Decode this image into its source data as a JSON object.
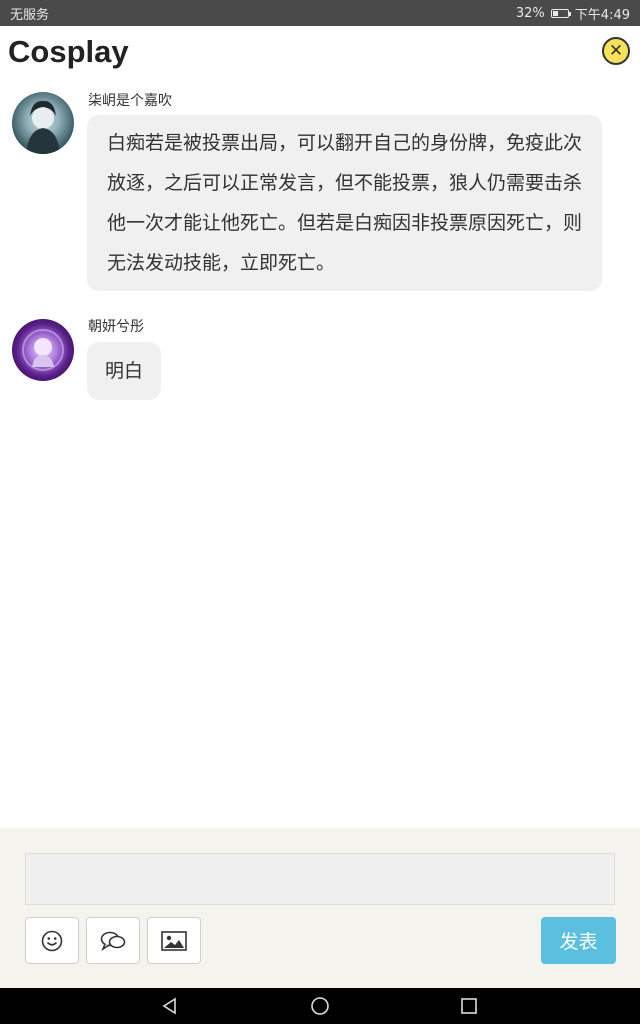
{
  "status_bar": {
    "carrier": "无服务",
    "battery": "32%",
    "time": "下午4:49",
    "battery_level": 0.32
  },
  "header": {
    "title": "Cosplay",
    "close_symbol": "✕"
  },
  "messages": [
    {
      "sender": "柒岄是个嘉吹",
      "text": "白痴若是被投票出局，可以翻开自己的身份牌，免疫此次放逐，之后可以正常发言，但不能投票，狼人仍需要击杀他一次才能让他死亡。但若是白痴因非投票原因死亡，则无法发动技能，立即死亡。"
    },
    {
      "sender": "朝妍兮彤",
      "text": "明白"
    }
  ],
  "composer": {
    "input_value": "",
    "send_label": "发表",
    "send_color": "#5bbfe0"
  },
  "icons": [
    "emoji-icon",
    "chat-bubbles-icon",
    "image-icon",
    "back-icon",
    "home-icon",
    "recents-icon"
  ]
}
